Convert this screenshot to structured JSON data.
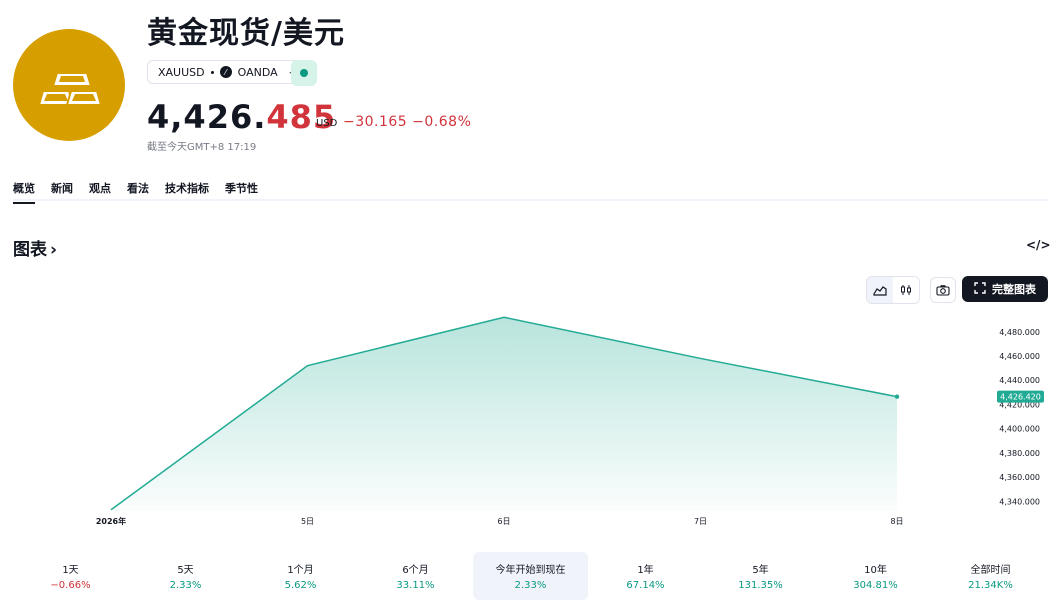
{
  "header": {
    "title": "黄金现货/美元",
    "symbol": "XAUUSD",
    "broker": "OANDA",
    "price_main": "4,426.",
    "price_tail": "485",
    "currency": "USD",
    "change": "−30.165 −0.68%",
    "as_of": "截至今天GMT+8 17:19"
  },
  "tabs": [
    {
      "label": "概览",
      "active": true
    },
    {
      "label": "新闻"
    },
    {
      "label": "观点"
    },
    {
      "label": "看法"
    },
    {
      "label": "技术指标"
    },
    {
      "label": "季节性"
    }
  ],
  "section": {
    "title": "图表",
    "chevron": "›",
    "embed_icon": "</>"
  },
  "toolbar": {
    "fullchart_label": "完整图表"
  },
  "chart_data": {
    "type": "area",
    "x": [
      "2026年",
      "5日",
      "6日",
      "7日",
      "8日"
    ],
    "values": [
      4333,
      4452,
      4492,
      4458,
      4426.42
    ],
    "ylim": [
      4332,
      4498
    ],
    "yticks": [
      4340,
      4360,
      4380,
      4400,
      4420,
      4440,
      4460,
      4480
    ],
    "ytick_labels": [
      "4,340.000",
      "4,360.000",
      "4,380.000",
      "4,400.000",
      "4,420.000",
      "4,440.000",
      "4,460.000",
      "4,480.000"
    ],
    "last_value_label": "4,426.420",
    "line_color": "#22ab94",
    "fill_color": "#22ab94",
    "grid": false
  },
  "periods": [
    {
      "label": "1天",
      "value": "−0.66%",
      "dir": "down"
    },
    {
      "label": "5天",
      "value": "2.33%",
      "dir": "up"
    },
    {
      "label": "1个月",
      "value": "5.62%",
      "dir": "up"
    },
    {
      "label": "6个月",
      "value": "33.11%",
      "dir": "up"
    },
    {
      "label": "今年开始到现在",
      "value": "2.33%",
      "dir": "up",
      "active": true
    },
    {
      "label": "1年",
      "value": "67.14%",
      "dir": "up"
    },
    {
      "label": "5年",
      "value": "131.35%",
      "dir": "up"
    },
    {
      "label": "10年",
      "value": "304.81%",
      "dir": "up"
    },
    {
      "label": "全部时间",
      "value": "21.34K%",
      "dir": "up"
    }
  ]
}
